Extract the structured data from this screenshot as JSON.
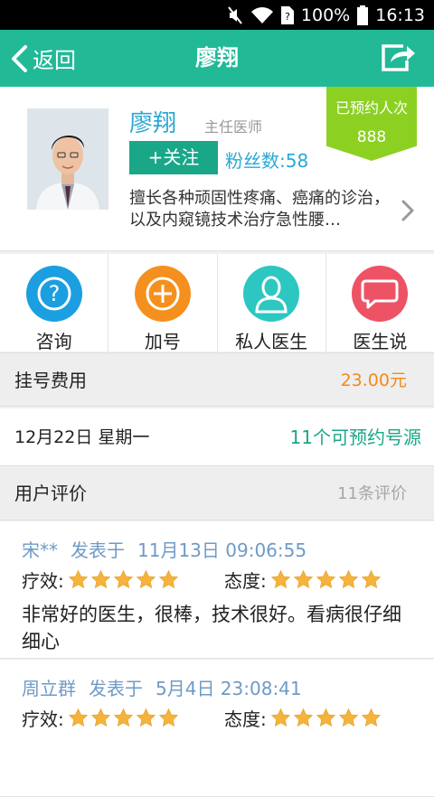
{
  "status_bar": {
    "battery": "100%",
    "time": "16:13"
  },
  "header": {
    "back_label": "返回",
    "title": "廖翔"
  },
  "doctor": {
    "name": "廖翔",
    "title": "主任医师",
    "follow_label": "+关注",
    "fans_label": "粉丝数:",
    "fans_count": "58",
    "description": "擅长各种顽固性疼痛、癌痛的诊治，以及内窥镜技术治疗急性腰…"
  },
  "badge": {
    "label": "已预约人次",
    "count": "888"
  },
  "actions": [
    {
      "label": "咨询",
      "icon": "question-icon",
      "color": "#1b9fe0"
    },
    {
      "label": "加号",
      "icon": "plus-icon",
      "color": "#f5901e"
    },
    {
      "label": "私人医生",
      "icon": "person-icon",
      "color": "#2dc7c2"
    },
    {
      "label": "医生说",
      "icon": "speech-bubble-icon",
      "color": "#ee5365"
    }
  ],
  "fee": {
    "label": "挂号费用",
    "value": "23.00元"
  },
  "schedule": {
    "date": "12月22日 星期一",
    "availability": "11个可预约号源"
  },
  "reviews_header": {
    "label": "用户评价",
    "count": "11条评价"
  },
  "reviews": [
    {
      "user": "宋**",
      "posted_label": "发表于",
      "datetime": "11月13日 09:06:55",
      "effect_label": "疗效:",
      "effect_stars": 5,
      "attitude_label": "态度:",
      "attitude_stars": 5,
      "text": "非常好的医生，很棒，技术很好。看病很仔细细心"
    },
    {
      "user": "周立群",
      "posted_label": "发表于",
      "datetime": "5月4日 23:08:41",
      "effect_label": "疗效:",
      "effect_stars": 5,
      "attitude_label": "态度:",
      "attitude_stars": 5,
      "text": ""
    }
  ],
  "colors": {
    "primary": "#22b997",
    "follow_button": "#1aa788",
    "badge": "#8cd122",
    "fee": "#f28a1c",
    "link_blue": "#2aa8d4",
    "star": "#f5b33b"
  }
}
